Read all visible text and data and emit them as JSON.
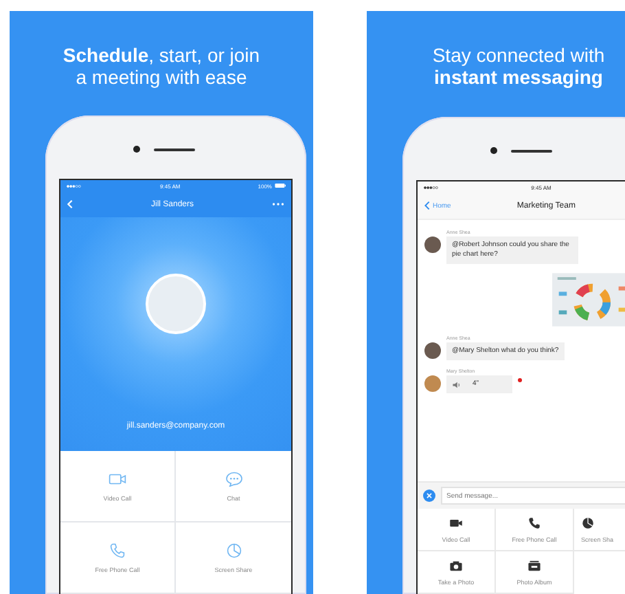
{
  "left_panel": {
    "headline": [
      "**Schedule**, start, or join",
      "a meeting with ease"
    ],
    "status_time": "9:45 AM",
    "status_battery": "100%",
    "title": "Jill Sanders",
    "email": "jill.sanders@company.com",
    "actions": [
      {
        "label": "Video Call",
        "kind": "video"
      },
      {
        "label": "Chat",
        "kind": "chat"
      },
      {
        "label": "Free Phone Call",
        "kind": "phone"
      },
      {
        "label": "Screen Share",
        "kind": "share"
      }
    ]
  },
  "right_panel": {
    "headline": [
      "Stay connected with",
      "**instant messaging**"
    ],
    "status_time": "9:45 AM",
    "back_label": "Home",
    "title": "Marketing Team",
    "messages": [
      {
        "kind": "text",
        "sender": "Anne Shea",
        "text": "@Robert Johnson could you share the pie chart here?"
      },
      {
        "kind": "image"
      },
      {
        "kind": "text",
        "sender": "Anne Shea",
        "text": "@Mary Shelton what do you think?"
      },
      {
        "kind": "voice",
        "sender": "Mary Shelton",
        "duration": "4\"",
        "unread": true
      }
    ],
    "input_placeholder": "Send message...",
    "actions": [
      {
        "label": "Video Call",
        "kind": "video"
      },
      {
        "label": "Free Phone Call",
        "kind": "phone"
      },
      {
        "label": "Screen Sha",
        "kind": "share"
      },
      {
        "label": "Take a Photo",
        "kind": "camera"
      },
      {
        "label": "Photo Album",
        "kind": "album"
      }
    ]
  }
}
